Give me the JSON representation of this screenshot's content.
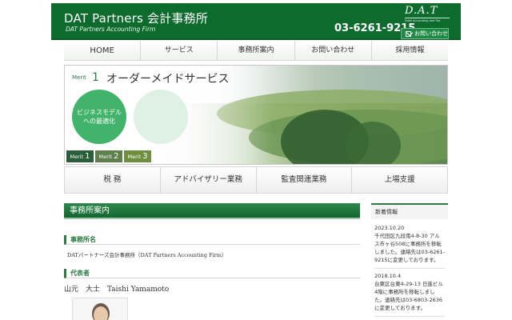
{
  "header": {
    "title": "DAT Partners 会計事務所",
    "subtitle": "DAT Partners Accounting Firm",
    "phone": "03-6261-9215",
    "logo_mark": "D.A.T",
    "logo_tagline": "Daiei Accounting and Tax",
    "contact_button": "お問い合わせ",
    "bg_color": "#0d6b2e"
  },
  "nav": {
    "items": [
      "HOME",
      "サービス",
      "事務所案内",
      "お問い合わせ",
      "採用情報"
    ]
  },
  "hero": {
    "merit_label": "Merit",
    "merit_number": "1",
    "merit_title": "オーダーメイドサービス",
    "circle_text_line1": "ビジネスモデル",
    "circle_text_line2": "への最適化",
    "tabs": [
      {
        "label": "Merit",
        "num": "1"
      },
      {
        "label": "Merit",
        "num": "2"
      },
      {
        "label": "Merit",
        "num": "3"
      }
    ]
  },
  "services": {
    "items": [
      "税 務",
      "アドバイザリー業務",
      "監査関連業務",
      "上場支援"
    ]
  },
  "main": {
    "heading": "事務所案内",
    "firm_section_title": "事務所名",
    "firm_name": "DATパートナーズ会計事務所（DAT Partners Accounting Firm）",
    "rep_section_title": "代表者",
    "rep_name": "山元　大士　Taishi Yamamoto"
  },
  "sidebar": {
    "heading": "新着情報",
    "news": [
      {
        "date": "2023.10.20",
        "body": "千代田区九段南4-8-30 アルス市ヶ谷508に事務所を移転しました。連絡先は03-6261-9215に変更しております。"
      },
      {
        "date": "2018.10.4",
        "body": "台東区台東4-29-13 日進ビル4階に事務所を移転しました。連絡先は03-6803-2636に変更しております。"
      }
    ]
  }
}
